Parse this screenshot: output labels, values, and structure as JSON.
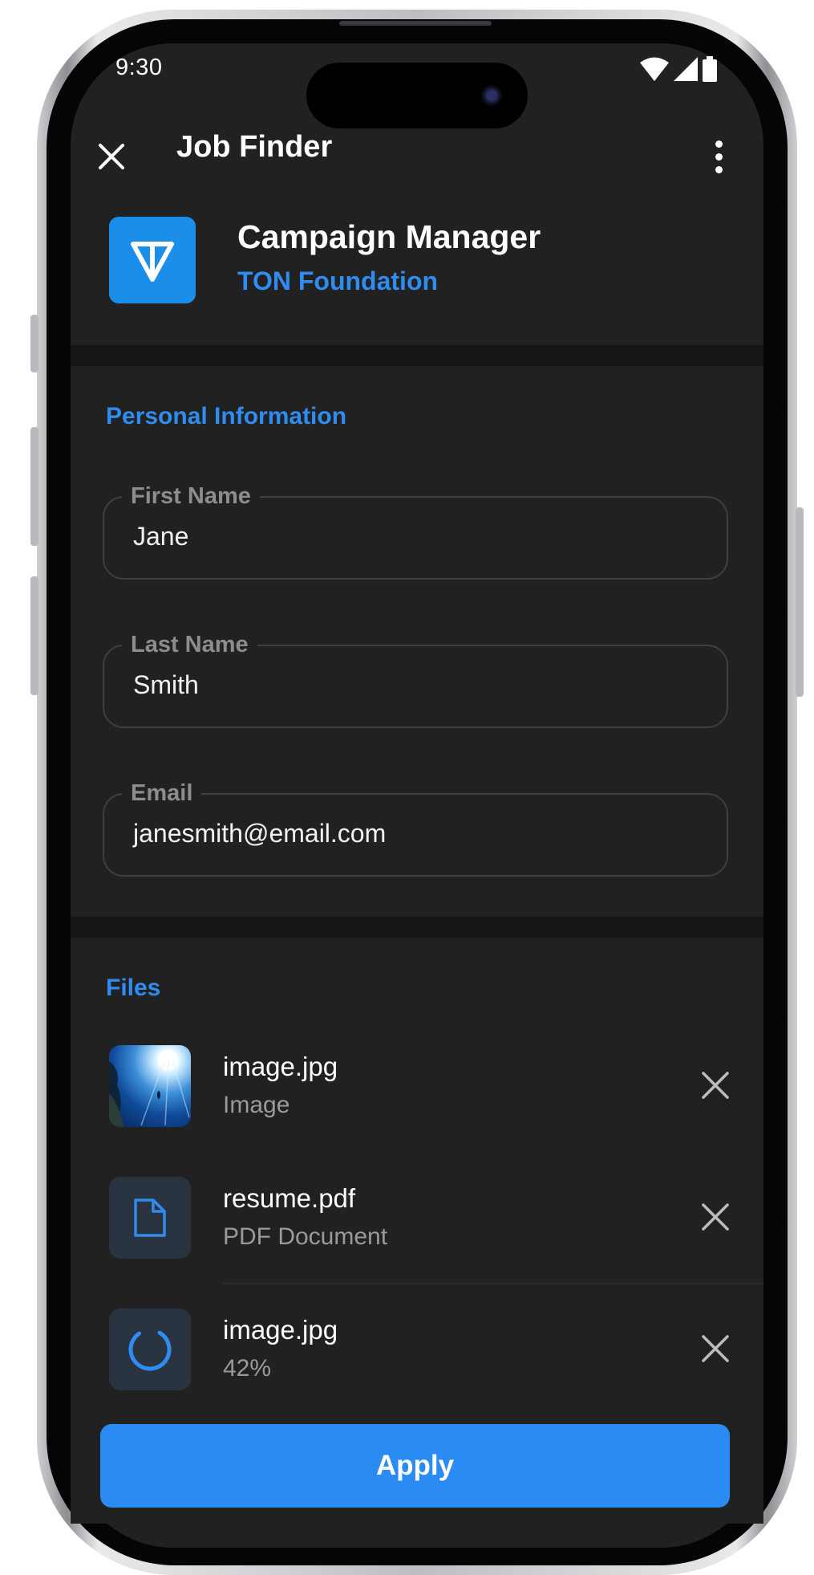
{
  "status_bar": {
    "time": "9:30"
  },
  "app_bar": {
    "title": "Job Finder"
  },
  "job": {
    "title": "Campaign Manager",
    "company": "TON Foundation",
    "brand_color": "#1a8ee8"
  },
  "personal_info": {
    "header": "Personal Information",
    "fields": [
      {
        "label": "First Name",
        "value": "Jane"
      },
      {
        "label": "Last Name",
        "value": "Smith"
      },
      {
        "label": "Email",
        "value": "janesmith@email.com"
      }
    ]
  },
  "files": {
    "header": "Files",
    "items": [
      {
        "name": "image.jpg",
        "subtitle": "Image",
        "icon": "image-thumbnail"
      },
      {
        "name": "resume.pdf",
        "subtitle": "PDF Document",
        "icon": "document-icon"
      },
      {
        "name": "image.jpg",
        "subtitle": "42%",
        "icon": "progress-spinner-icon",
        "progress": 0.42
      }
    ]
  },
  "apply_button": {
    "label": "Apply"
  },
  "colors": {
    "accent": "#2a8bf2",
    "background": "#212121",
    "surface_dark": "#151515"
  }
}
